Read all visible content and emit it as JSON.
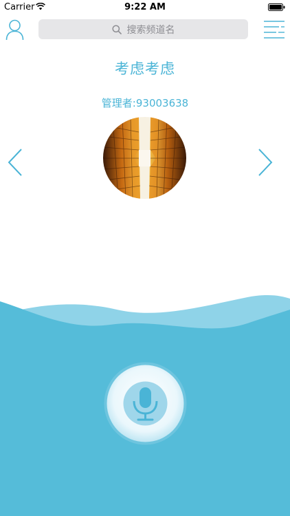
{
  "status_bar": {
    "carrier": "Carrier",
    "time": "9:22 AM"
  },
  "nav": {
    "search_placeholder": "搜索频道名"
  },
  "channel": {
    "title": "考虑考虑",
    "manager": "管理者:93003638"
  },
  "colors": {
    "accent": "#4ab4d6",
    "wave_light": "#7fcbe3",
    "wave_main": "#55bcd9",
    "mic_inner": "#9fd6ea"
  },
  "icons": {
    "user": "user-icon",
    "search": "search-icon",
    "menu": "menu-icon",
    "prev": "chevron-left-icon",
    "next": "chevron-right-icon",
    "mic": "microphone-icon"
  }
}
